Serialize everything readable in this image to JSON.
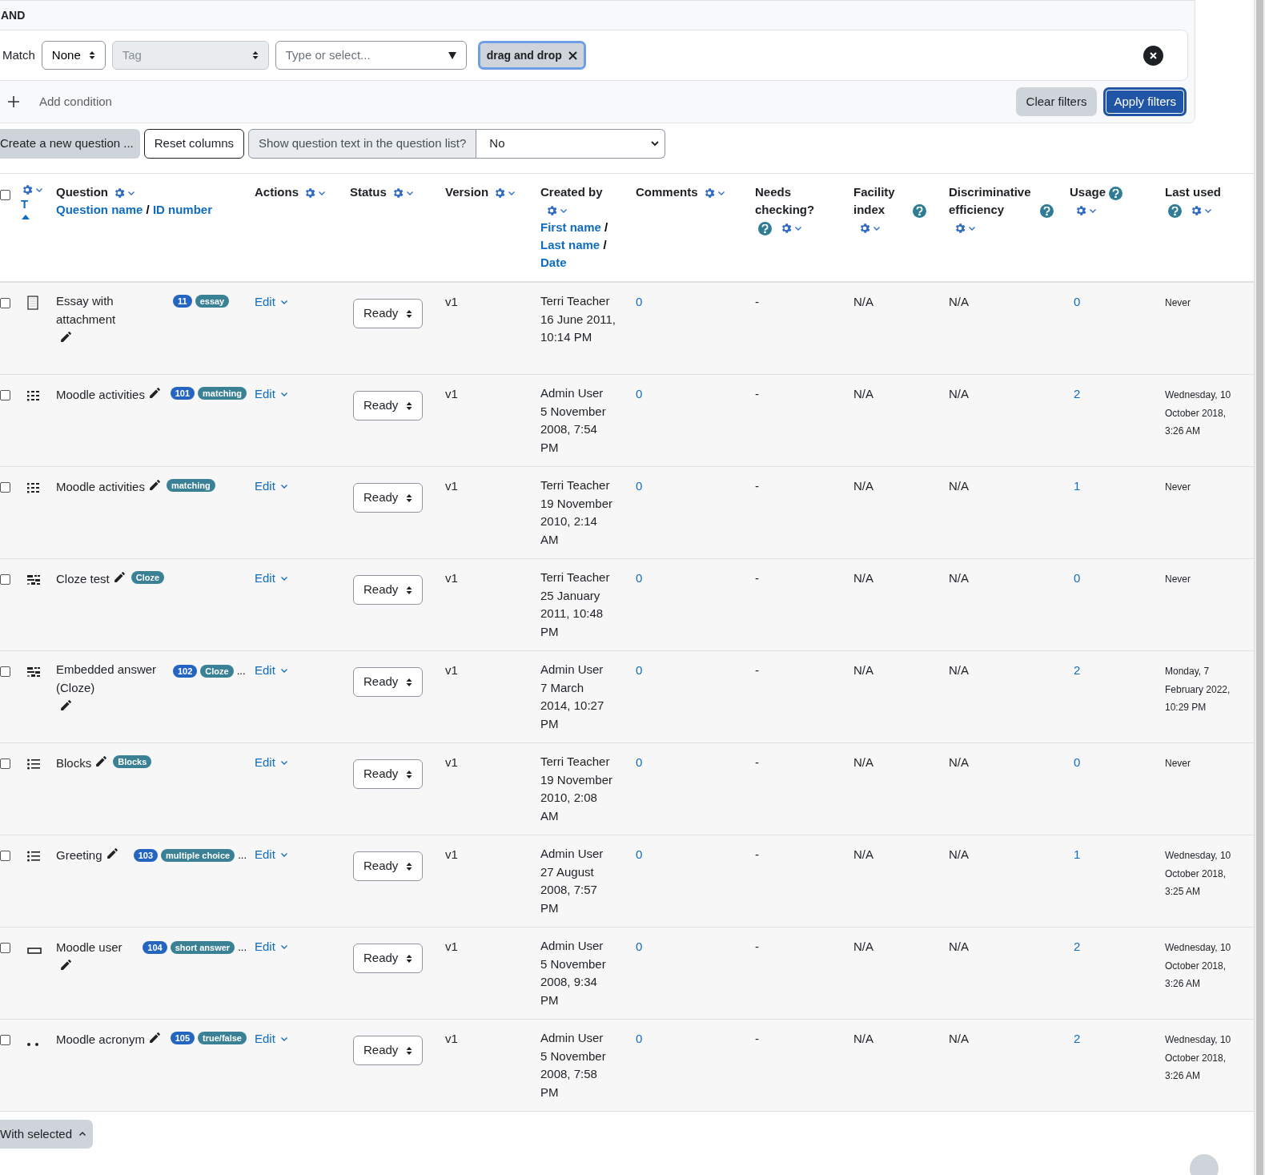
{
  "filter": {
    "join": "AND",
    "match_label": "Match",
    "match_value": "None",
    "field_placeholder": "Tag",
    "search_placeholder": "Type or select...",
    "chips": [
      "drag and drop"
    ],
    "add_condition": "Add condition",
    "clear": "Clear filters",
    "apply": "Apply filters"
  },
  "toolbar": {
    "create": "Create a new question ...",
    "reset": "Reset columns",
    "show_text_label": "Show question text in the question list?",
    "show_text_value": "No"
  },
  "table": {
    "select_all_checked": false,
    "columns": [
      {
        "kind": "type",
        "label": "T",
        "sort_ascending": true
      },
      {
        "kind": "text",
        "label": "Question",
        "links": [
          "Question name",
          "ID number"
        ],
        "link_separator": "/"
      },
      {
        "kind": "text",
        "label": "Actions"
      },
      {
        "kind": "text",
        "label": "Status"
      },
      {
        "kind": "text",
        "label": "Version"
      },
      {
        "kind": "text",
        "label": "Created by",
        "links": [
          "First name",
          "Last name",
          "Date"
        ],
        "link_separator": "/"
      },
      {
        "kind": "text",
        "label": "Comments"
      },
      {
        "kind": "text",
        "label": "Needs checking?",
        "help": true
      },
      {
        "kind": "text",
        "label": "Facility index",
        "help": true
      },
      {
        "kind": "text",
        "label": "Discriminative efficiency",
        "help": true
      },
      {
        "kind": "text",
        "label": "Usage",
        "help": true
      },
      {
        "kind": "text",
        "label": "Last used",
        "help": true
      }
    ],
    "rows": [
      {
        "checked": false,
        "kind": "essay",
        "name": "Essay with attachment",
        "id_number": "11",
        "tag": "essay",
        "more": "",
        "action": "Edit",
        "status": "Ready",
        "version": "v1",
        "created_by": "Terri Teacher",
        "created": "16 June 2011, 10:14 PM",
        "comments": "0",
        "needs_checking": "-",
        "facility": "N/A",
        "discrimination": "N/A",
        "usage": "0",
        "last_used": "Never"
      },
      {
        "checked": false,
        "kind": "matching",
        "name": "Moodle activities",
        "id_number": "101",
        "tag": "matching",
        "more": "",
        "action": "Edit",
        "status": "Ready",
        "version": "v1",
        "created_by": "Admin User",
        "created": "5 November 2008, 7:54 PM",
        "comments": "0",
        "needs_checking": "-",
        "facility": "N/A",
        "discrimination": "N/A",
        "usage": "2",
        "last_used": "Wednesday, 10 October 2018, 3:26 AM"
      },
      {
        "checked": false,
        "kind": "matching",
        "name": "Moodle activities",
        "id_number": "",
        "tag": "matching",
        "more": "",
        "action": "Edit",
        "status": "Ready",
        "version": "v1",
        "created_by": "Terri Teacher",
        "created": "19 November 2010, 2:14 AM",
        "comments": "0",
        "needs_checking": "-",
        "facility": "N/A",
        "discrimination": "N/A",
        "usage": "1",
        "last_used": "Never"
      },
      {
        "checked": false,
        "kind": "cloze",
        "name": "Cloze test",
        "id_number": "",
        "tag": "Cloze",
        "more": "",
        "action": "Edit",
        "status": "Ready",
        "version": "v1",
        "created_by": "Terri Teacher",
        "created": "25 January 2011, 10:48 PM",
        "comments": "0",
        "needs_checking": "-",
        "facility": "N/A",
        "discrimination": "N/A",
        "usage": "0",
        "last_used": "Never"
      },
      {
        "checked": false,
        "kind": "cloze",
        "name": "Embedded answer (Cloze)",
        "id_number": "102",
        "tag": "Cloze",
        "more": "...",
        "action": "Edit",
        "status": "Ready",
        "version": "v1",
        "created_by": "Admin User",
        "created": "7 March 2014, 10:27 PM",
        "comments": "0",
        "needs_checking": "-",
        "facility": "N/A",
        "discrimination": "N/A",
        "usage": "2",
        "last_used": "Monday, 7 February 2022, 10:29 PM"
      },
      {
        "checked": false,
        "kind": "multichoice",
        "name": "Blocks",
        "id_number": "",
        "tag": "Blocks",
        "more": "",
        "action": "Edit",
        "status": "Ready",
        "version": "v1",
        "created_by": "Terri Teacher",
        "created": "19 November 2010, 2:08 AM",
        "comments": "0",
        "needs_checking": "-",
        "facility": "N/A",
        "discrimination": "N/A",
        "usage": "0",
        "last_used": "Never"
      },
      {
        "checked": false,
        "kind": "multichoice",
        "name": "Greeting",
        "id_number": "103",
        "tag": "multiple choice",
        "more": "...",
        "action": "Edit",
        "status": "Ready",
        "version": "v1",
        "created_by": "Admin User",
        "created": "27 August 2008, 7:57 PM",
        "comments": "0",
        "needs_checking": "-",
        "facility": "N/A",
        "discrimination": "N/A",
        "usage": "1",
        "last_used": "Wednesday, 10 October 2018, 3:25 AM"
      },
      {
        "checked": false,
        "kind": "shortanswer",
        "name": "Moodle user",
        "id_number": "104",
        "tag": "short answer",
        "more": "...",
        "action": "Edit",
        "status": "Ready",
        "version": "v1",
        "created_by": "Admin User",
        "created": "5 November 2008, 9:34 PM",
        "comments": "0",
        "needs_checking": "-",
        "facility": "N/A",
        "discrimination": "N/A",
        "usage": "2",
        "last_used": "Wednesday, 10 October 2018, 3:26 AM"
      },
      {
        "checked": false,
        "kind": "truefalse",
        "name": "Moodle acronym",
        "id_number": "105",
        "tag": "true/false",
        "more": "",
        "action": "Edit",
        "status": "Ready",
        "version": "v1",
        "created_by": "Admin User",
        "created": "5 November 2008, 7:58 PM",
        "comments": "0",
        "needs_checking": "-",
        "facility": "N/A",
        "discrimination": "N/A",
        "usage": "2",
        "last_used": "Wednesday, 10 October 2018, 3:26 AM"
      }
    ]
  },
  "bulk": {
    "label": "With selected"
  }
}
